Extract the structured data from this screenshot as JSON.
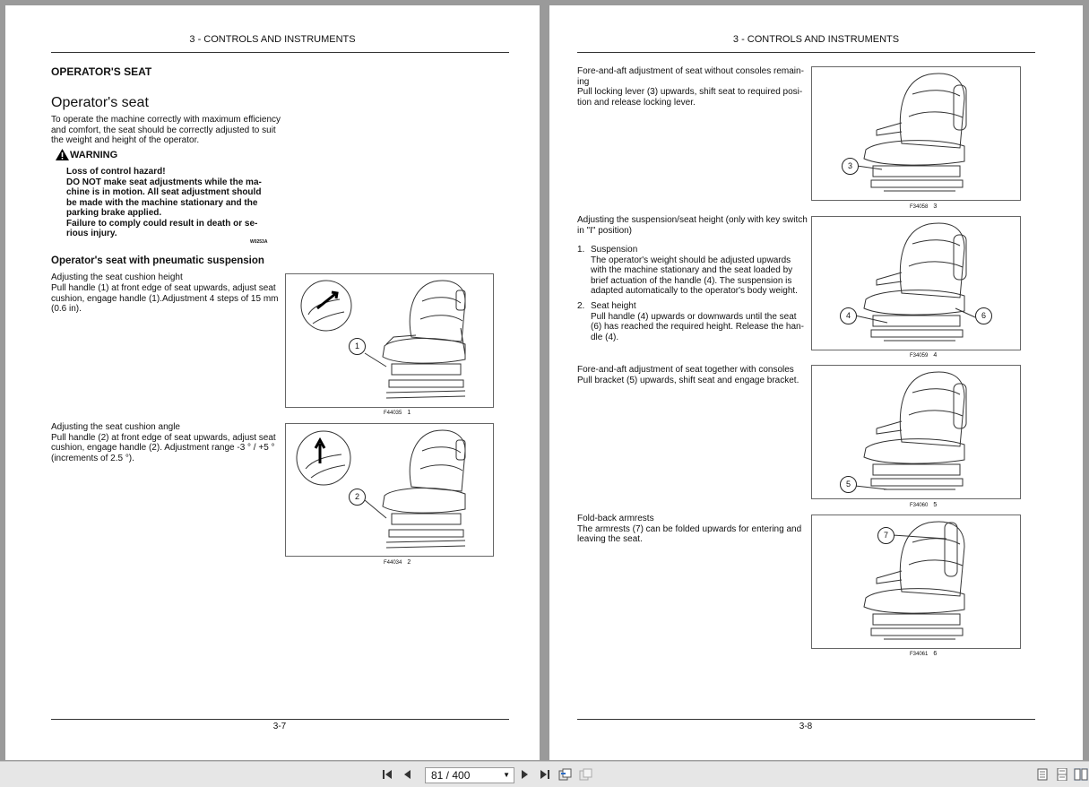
{
  "left_page": {
    "header": "3 - CONTROLS AND INSTRUMENTS",
    "section_title": "OPERATOR'S SEAT",
    "heading": "Operator's seat",
    "intro": [
      "To operate the machine correctly with maximum efficiency",
      "and comfort, the seat should be correctly adjusted to suit",
      "the weight and height of the operator."
    ],
    "warning": {
      "title": "WARNING",
      "lines": [
        "Loss of control hazard!",
        "DO NOT make seat adjustments while the ma-",
        "chine is in motion. All seat adjustment should",
        "be made with the machine stationary and the",
        "parking brake applied.",
        "Failure to comply could result in death or se-",
        "rious injury."
      ],
      "code": "W0253A"
    },
    "subheading": "Operator's seat with pneumatic suspension",
    "cushion_height": {
      "title": "Adjusting the seat cushion height",
      "lines": [
        "Pull handle (1) at front edge of seat upwards, adjust seat",
        "cushion, engage handle (1).Adjustment 4 steps of 15 mm",
        "(0.6 in)."
      ]
    },
    "cushion_angle": {
      "title": "Adjusting the seat cushion angle",
      "lines": [
        "Pull handle (2) at front edge of seat upwards, adjust seat",
        "cushion, engage handle (2). Adjustment range -3 ° / +5 °",
        "(increments of 2.5 °)."
      ]
    },
    "fig1": {
      "code": "F44035",
      "num": "1",
      "callout": "1"
    },
    "fig2": {
      "code": "F44034",
      "num": "2",
      "callout": "2"
    },
    "page_number": "3-7"
  },
  "right_page": {
    "header": "3 - CONTROLS AND INSTRUMENTS",
    "fore_aft": {
      "lines": [
        "Fore-and-aft adjustment of seat without consoles remain-",
        "ing",
        "Pull locking lever (3) upwards, shift seat to required posi-",
        "tion and release locking lever."
      ]
    },
    "suspension": {
      "title_lines": [
        "Adjusting the suspension/seat height (only with key switch",
        "in \"I\" position)"
      ],
      "item1_num": "1.",
      "item1_title": "Suspension",
      "item1_lines": [
        "The operator's weight should be adjusted upwards",
        "with the machine stationary and the seat loaded by",
        "brief actuation of the handle (4).  The suspension is",
        "adapted automatically to the operator's body weight."
      ],
      "item2_num": "2.",
      "item2_title": "Seat height",
      "item2_lines": [
        "Pull handle (4) upwards or downwards until the seat",
        "(6) has reached the required height. Release the han-",
        "dle (4)."
      ]
    },
    "consoles": {
      "lines": [
        "Fore-and-aft adjustment of seat together with consoles",
        "Pull bracket (5) upwards, shift seat and engage bracket."
      ]
    },
    "armrests": {
      "lines": [
        "Fold-back armrests",
        "The armrests (7) can be folded upwards for entering and",
        "leaving the seat."
      ]
    },
    "fig3": {
      "code": "F34058",
      "num": "3",
      "callout": "3"
    },
    "fig4": {
      "code": "F34059",
      "num": "4",
      "callout_a": "4",
      "callout_b": "6"
    },
    "fig5": {
      "code": "F34060",
      "num": "5",
      "callout": "5"
    },
    "fig6": {
      "code": "F34061",
      "num": "6",
      "callout": "7"
    },
    "page_number": "3-8"
  },
  "toolbar": {
    "page_indicator": "81 / 400",
    "icons": [
      "first-page-icon",
      "prev-page-icon",
      "next-page-icon",
      "last-page-icon",
      "previous-view-icon",
      "next-view-icon",
      "single-page-view-icon",
      "continuous-view-icon",
      "two-page-view-icon"
    ]
  }
}
